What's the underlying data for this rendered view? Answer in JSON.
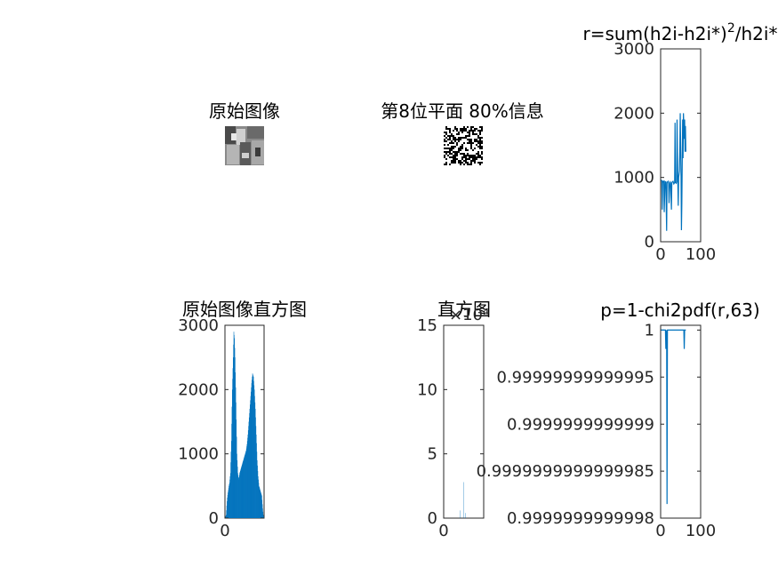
{
  "colors": {
    "line": "#0072BD",
    "axis": "#262626",
    "background": "#ffffff"
  },
  "panels": {
    "original_image": {
      "title": "原始图像",
      "image": "grayscale photograph (pepper-like objects)"
    },
    "bitplane": {
      "title": "第8位平面 80%信息",
      "image": "binary noise pattern (bit plane with hidden information)"
    },
    "histogram_original": {
      "title": "原始图像直方图"
    },
    "histogram_stego": {
      "title": "直方图",
      "exponent_label": "×10⁴"
    }
  },
  "chart_data": [
    {
      "id": "r-plot",
      "type": "line",
      "title_base": "r=sum(h2i-h2i*)",
      "title_sup": "2",
      "title_tail": "/h2i*",
      "xlim": [
        0,
        100
      ],
      "ylim": [
        0,
        3000
      ],
      "xticks": [
        "0",
        "100"
      ],
      "yticks": [
        "0",
        "1000",
        "2000",
        "3000"
      ],
      "x": [
        1,
        3,
        4,
        5,
        7,
        8,
        9,
        11,
        12,
        13,
        15,
        16,
        17,
        19,
        20,
        21,
        23,
        24,
        25,
        27,
        28,
        29,
        31,
        32,
        33,
        35,
        36,
        37,
        39,
        40,
        41,
        43,
        44,
        45,
        47,
        48,
        49,
        51,
        52,
        53,
        55,
        56,
        57,
        59,
        60,
        61,
        62,
        63
      ],
      "y": [
        960,
        950,
        500,
        940,
        930,
        950,
        460,
        930,
        920,
        940,
        170,
        920,
        930,
        940,
        900,
        600,
        920,
        930,
        910,
        500,
        920,
        930,
        940,
        920,
        900,
        920,
        1850,
        920,
        910,
        930,
        1900,
        920,
        560,
        1000,
        1100,
        1400,
        2000,
        1050,
        180,
        600,
        1900,
        1300,
        2000,
        1600,
        1900,
        1400,
        1800,
        1400
      ]
    },
    {
      "id": "hist-original",
      "type": "bar",
      "title": "原始图像直方图",
      "xlim": [
        0,
        255
      ],
      "ylim": [
        0,
        3000
      ],
      "xticks": [
        "0"
      ],
      "yticks": [
        "0",
        "1000",
        "2000",
        "3000"
      ],
      "envelope": [
        [
          0,
          0
        ],
        [
          8,
          50
        ],
        [
          15,
          300
        ],
        [
          20,
          400
        ],
        [
          26,
          500
        ],
        [
          30,
          550
        ],
        [
          36,
          700
        ],
        [
          42,
          1200
        ],
        [
          48,
          2000
        ],
        [
          54,
          2500
        ],
        [
          58,
          2900
        ],
        [
          62,
          2800
        ],
        [
          66,
          2500
        ],
        [
          72,
          1800
        ],
        [
          78,
          1000
        ],
        [
          84,
          700
        ],
        [
          90,
          600
        ],
        [
          96,
          700
        ],
        [
          102,
          750
        ],
        [
          108,
          800
        ],
        [
          114,
          850
        ],
        [
          120,
          900
        ],
        [
          126,
          950
        ],
        [
          132,
          1000
        ],
        [
          138,
          1050
        ],
        [
          144,
          1150
        ],
        [
          150,
          1300
        ],
        [
          156,
          1500
        ],
        [
          162,
          1700
        ],
        [
          168,
          1900
        ],
        [
          174,
          2100
        ],
        [
          180,
          2250
        ],
        [
          186,
          2200
        ],
        [
          192,
          2000
        ],
        [
          198,
          1700
        ],
        [
          204,
          1300
        ],
        [
          210,
          900
        ],
        [
          216,
          650
        ],
        [
          222,
          500
        ],
        [
          228,
          450
        ],
        [
          234,
          400
        ],
        [
          240,
          350
        ],
        [
          246,
          150
        ],
        [
          250,
          50
        ],
        [
          255,
          0
        ]
      ],
      "comb_lows": [
        [
          0,
          0
        ],
        [
          60,
          150
        ],
        [
          120,
          350
        ],
        [
          180,
          250
        ],
        [
          255,
          0
        ]
      ]
    },
    {
      "id": "hist-stego",
      "type": "bar",
      "title": "直方图",
      "xlim": [
        0,
        255
      ],
      "ylim": [
        0,
        15
      ],
      "xticks": [
        "0"
      ],
      "yticks": [
        "0",
        "5",
        "10",
        "15"
      ],
      "exponent": "×10⁴",
      "bars": [
        {
          "x": 128,
          "value": 2.8
        },
        {
          "x": 105,
          "value": 0.6
        },
        {
          "x": 140,
          "value": 0.4
        }
      ]
    },
    {
      "id": "p-plot",
      "type": "line",
      "title": "p=1-chi2pdf(r,63)",
      "xlim": [
        0,
        100
      ],
      "ylim": [
        0.9999999999998,
        1.000000000000005
      ],
      "xticks": [
        "0",
        "100"
      ],
      "yticks": [
        "0.9999999999998",
        "0.9999999999998500",
        "0.999999999999900",
        "0.999999999999950",
        "1"
      ],
      "ytick_labels": [
        "0.9999999999998",
        "0.9999999999999985",
        "0.9999999999999",
        "0.99999999999995",
        "1"
      ],
      "ytick_values": [
        0.9999999999998,
        0.99999999999985,
        0.9999999999999,
        0.99999999999995,
        1.0
      ],
      "x": [
        1,
        10,
        11,
        12,
        13,
        14,
        15,
        16,
        17,
        18,
        20,
        30,
        40,
        50,
        55,
        57,
        58,
        59,
        60,
        61,
        62,
        63
      ],
      "y": [
        1.0,
        1.0,
        1.0,
        1.0,
        0.99999999999998,
        0.99999999999999,
        1.0,
        0.999999999999815,
        1.0,
        1.0,
        1.0,
        1.0,
        1.0,
        1.0,
        1.0,
        1.0,
        1.0,
        0.99999999999998,
        1.0,
        1.0,
        1.0,
        1.0
      ]
    }
  ]
}
